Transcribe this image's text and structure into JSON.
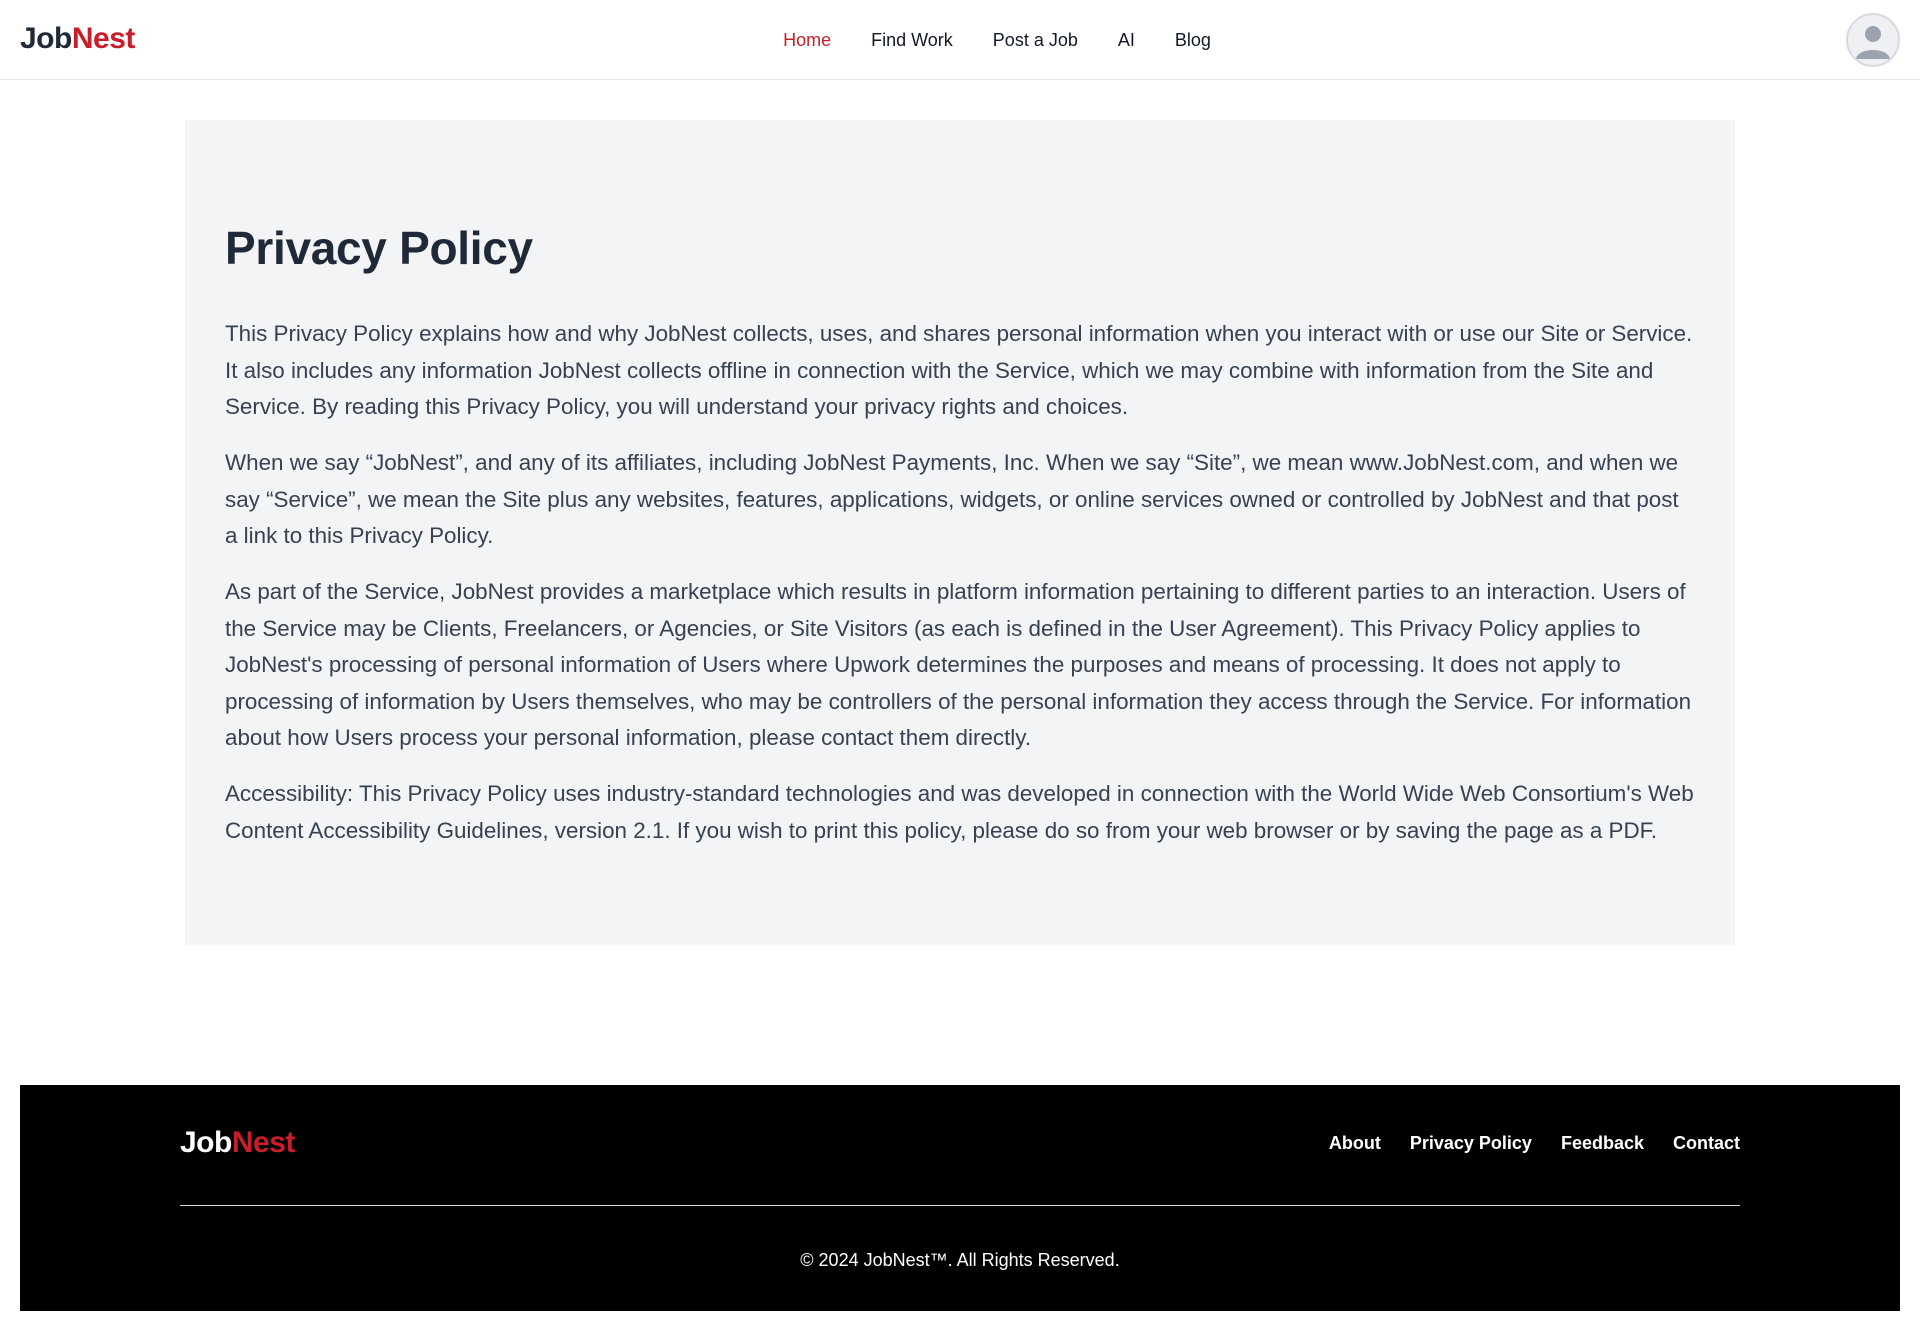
{
  "brand": {
    "part1": "Job",
    "part2": "Nest"
  },
  "nav": {
    "items": [
      {
        "label": "Home",
        "active": true
      },
      {
        "label": "Find Work",
        "active": false
      },
      {
        "label": "Post a Job",
        "active": false
      },
      {
        "label": "AI",
        "active": false
      },
      {
        "label": "Blog",
        "active": false
      }
    ]
  },
  "user": {
    "avatar_icon": "user-avatar-icon"
  },
  "policy": {
    "title": "Privacy Policy",
    "paragraphs": [
      "This Privacy Policy explains how and why JobNest collects, uses, and shares personal information when you interact with or use our Site or Service. It also includes any information JobNest collects offline in connection with the Service, which we may combine with information from the Site and Service. By reading this Privacy Policy, you will understand your privacy rights and choices.",
      "When we say “JobNest”, and any of its affiliates, including JobNest Payments, Inc. When we say “Site”, we mean www.JobNest.com, and when we say “Service”, we mean the Site plus any websites, features, applications, widgets, or online services owned or controlled by JobNest and that post a link to this Privacy Policy.",
      "As part of the Service, JobNest provides a marketplace which results in platform information pertaining to different parties to an interaction. Users of the Service may be Clients, Freelancers, or Agencies, or Site Visitors (as each is defined in the User Agreement). This Privacy Policy applies to JobNest's processing of personal information of Users where Upwork determines the purposes and means of processing. It does not apply to processing of information by Users themselves, who may be controllers of the personal information they access through the Service. For information about how Users process your personal information, please contact them directly.",
      "Accessibility: This Privacy Policy uses industry-standard technologies and was developed in connection with the World Wide Web Consortium's Web Content Accessibility Guidelines, version 2.1. If you wish to print this policy, please do so from your web browser or by saving the page as a PDF."
    ]
  },
  "footer": {
    "brand": {
      "part1": "Job",
      "part2": "Nest"
    },
    "links": [
      "About",
      "Privacy Policy",
      "Feedback",
      "Contact"
    ],
    "copyright": "© 2024 JobNest™. All Rights Reserved."
  },
  "colors": {
    "accent": "#c81e2b",
    "text_dark": "#1f2937",
    "card_bg": "#f3f4f6",
    "footer_bg": "#000000"
  }
}
